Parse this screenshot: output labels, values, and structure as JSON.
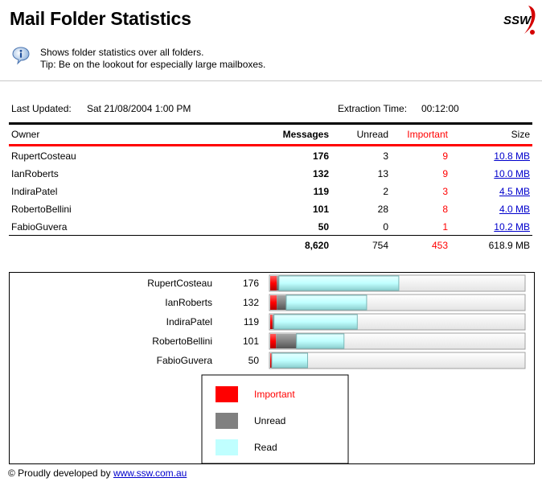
{
  "page": {
    "title": "Mail Folder Statistics",
    "logo_text": "SSW",
    "description_line1": "Shows folder statistics over all folders.",
    "description_line2": "Tip: Be on the lookout for especially large mailboxes."
  },
  "meta": {
    "last_updated_label": "Last Updated:",
    "last_updated_value": "Sat 21/08/2004 1:00 PM",
    "extraction_time_label": "Extraction Time:",
    "extraction_time_value": "00:12:00"
  },
  "table": {
    "headers": {
      "owner": "Owner",
      "messages": "Messages",
      "unread": "Unread",
      "important": "Important",
      "size": "Size"
    },
    "rows": [
      {
        "owner": "RupertCosteau",
        "messages": "176",
        "unread": "3",
        "important": "9",
        "size": "10.8 MB"
      },
      {
        "owner": "IanRoberts",
        "messages": "132",
        "unread": "13",
        "important": "9",
        "size": "10.0 MB"
      },
      {
        "owner": "IndiraPatel",
        "messages": "119",
        "unread": "2",
        "important": "3",
        "size": "4.5 MB"
      },
      {
        "owner": "RobertoBellini",
        "messages": "101",
        "unread": "28",
        "important": "8",
        "size": "4.0 MB"
      },
      {
        "owner": "FabioGuvera",
        "messages": "50",
        "unread": "0",
        "important": "1",
        "size": "10.2 MB"
      }
    ],
    "totals": {
      "messages": "8,620",
      "unread": "754",
      "important": "453",
      "size": "618.9 MB"
    }
  },
  "chart_data": {
    "type": "bar",
    "orientation": "horizontal",
    "stacked": true,
    "categories": [
      "RupertCosteau",
      "IanRoberts",
      "IndiraPatel",
      "RobertoBellini",
      "FabioGuvera"
    ],
    "totals": [
      176,
      132,
      119,
      101,
      50
    ],
    "series": [
      {
        "name": "Important",
        "values": [
          9,
          9,
          3,
          8,
          1
        ],
        "color": "#ff0000"
      },
      {
        "name": "Unread",
        "values": [
          3,
          13,
          2,
          28,
          0
        ],
        "color": "#808080"
      },
      {
        "name": "Read",
        "values": [
          164,
          110,
          114,
          65,
          49
        ],
        "color": "#c0ffff"
      }
    ],
    "xlim": [
      0,
      350
    ],
    "legend_placement": "bottom-center"
  },
  "footer": {
    "text": "© Proudly developed by",
    "link": "www.ssw.com.au"
  },
  "colors": {
    "important": "#ff0000",
    "link": "#0000cc",
    "bar_read": "#c0ffff",
    "bar_unread": "#808080"
  }
}
